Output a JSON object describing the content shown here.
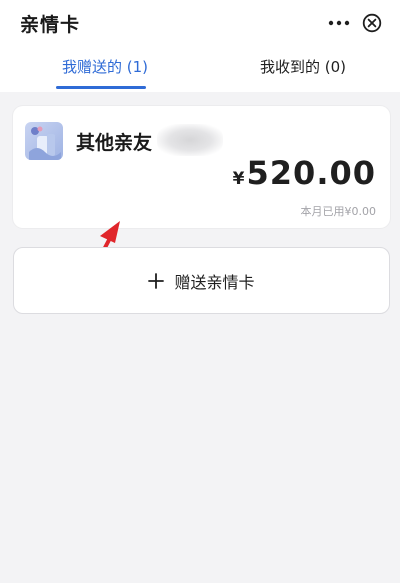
{
  "header": {
    "title": "亲情卡",
    "more_icon": "more-dots-icon",
    "close_icon": "close-circle-icon"
  },
  "tabs": [
    {
      "label": "我赠送的 (1)",
      "active": true
    },
    {
      "label": "我收到的 (0)",
      "active": false
    }
  ],
  "colors": {
    "accent": "#2f6bd6",
    "annotation_arrow": "#e0262b"
  },
  "card": {
    "thumbnail_icon": "card-thumbnail-image",
    "name": "其他亲友",
    "currency": "¥",
    "amount": "520.00",
    "usage": "本月已用¥0.00"
  },
  "gift_button": {
    "icon": "plus-icon",
    "label": "赠送亲情卡"
  }
}
